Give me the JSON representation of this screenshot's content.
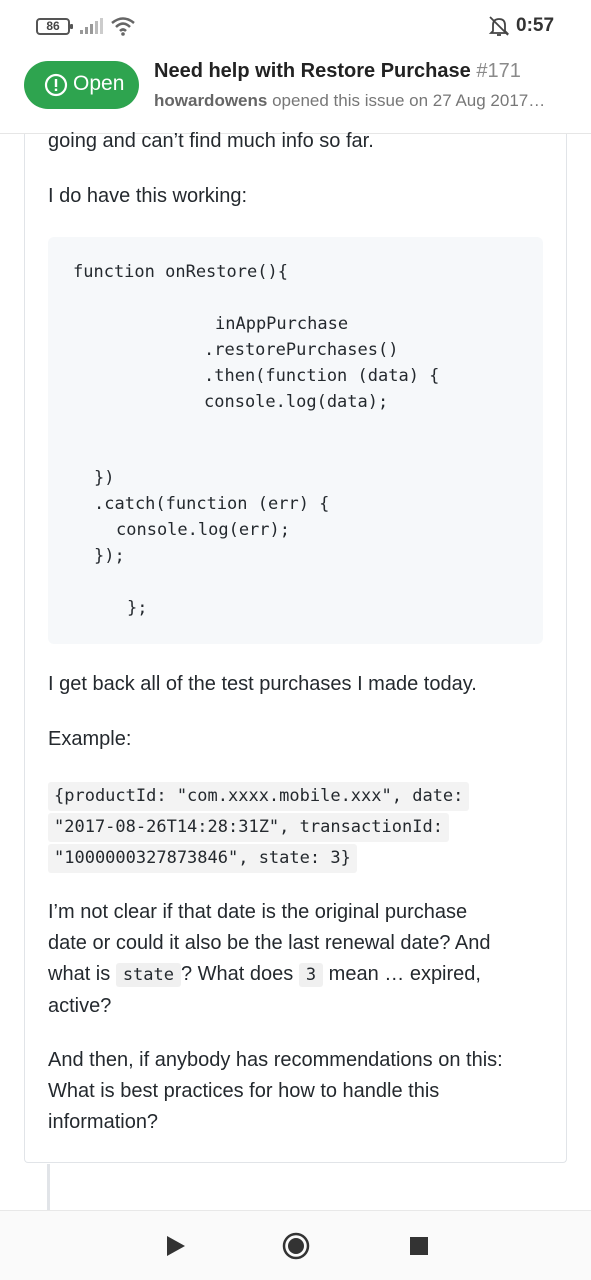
{
  "status_bar": {
    "battery": "86",
    "time": "0:57",
    "icons": [
      "signal-icon",
      "wifi-icon",
      "alarm-off-icon"
    ]
  },
  "header": {
    "state_label": "Open",
    "title": "Need help with Restore Purchase",
    "number": "#171",
    "author": "howardowens",
    "meta": "opened this issue on 27 Aug 2017…"
  },
  "comment": {
    "p_intro": "going and can’t find much info so far.",
    "p_working": "I do have this working:",
    "code_lines": [
      "function onRestore(){",
      "inAppPurchase",
      ".restorePurchases()",
      ".then(function (data) {",
      "console.log(data);",
      "})",
      ".catch(function (err) {",
      "console.log(err);",
      "});",
      "};"
    ],
    "p_results": "I get back all of the test purchases I made today.",
    "p_example": "Example:",
    "json_lines": [
      "{productId: \"com.xxxx.mobile.xxx\", date:",
      "\"2017-08-26T14:28:31Z\", transactionId:",
      "\"1000000327873846\", state: 3}"
    ],
    "q1_a": "I’m not clear if that date is the original purchase",
    "q1_b": "date or could it also be the last renewal date? And",
    "q1_c_pre": "what is",
    "q1_code_state": "state",
    "q1_c_mid": "? What does",
    "q1_code_3": "3",
    "q1_c_post": "mean … expired,",
    "q1_d": "active?",
    "q2_a": "And then, if anybody has recommendations on this:",
    "q2_b": "What is best practices for how to handle this",
    "q2_c": "information?"
  },
  "navbar": {
    "buttons": [
      "back-icon",
      "home-icon",
      "recents-icon"
    ]
  },
  "colors": {
    "open_green": "#2ea44f",
    "code_bg": "#f6f8fa",
    "text": "#24292e"
  }
}
